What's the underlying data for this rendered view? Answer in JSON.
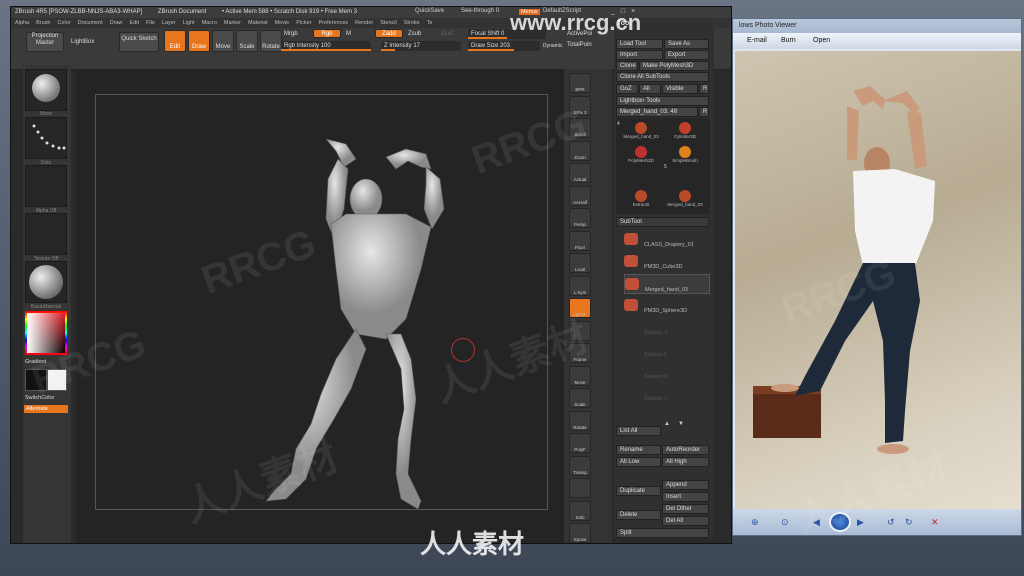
{
  "zbrush": {
    "title_parts": [
      "ZBrush 4R5 [PSOW-ZLBB-NNJS-ABA3-WHAP]",
      "ZBrush Document",
      "• Active Mem 588 • Scratch Disk 919 • Free Mem 3"
    ],
    "quicksave": "QuickSave",
    "seethrough": "See-through  0",
    "menus_btn": "Menus",
    "default_script": "DefaultZScript",
    "menu_items": [
      "Alpha",
      "Brush",
      "Color",
      "Document",
      "Draw",
      "Edit",
      "File",
      "Layer",
      "Light",
      "Macro",
      "Marker",
      "Material",
      "Movie",
      "Picker",
      "Preferences",
      "Render",
      "Stencil",
      "Stroke",
      "Te"
    ],
    "projection_master": "Projection Master",
    "lightbox": "LightBox",
    "quick_sketch": "Quick Sketch",
    "edit": "Edit",
    "draw": "Draw",
    "move": "Move",
    "scale": "Scale",
    "rotate": "Rotate",
    "mrgb": "Mrgb",
    "rgb": "Rgb",
    "m": "M",
    "zadd": "Zadd",
    "zsub": "Zsub",
    "zcut": "Zcut",
    "rgb_intensity": "Rgb Intensity 100",
    "z_intensity": "Z Intensity 17",
    "focal_shift": "Focal Shift 0",
    "draw_size": "Draw Size 203",
    "dynamic": "Dynamic",
    "active_points": "ActivePoi",
    "total_points": "TotalPoin",
    "left_caps": [
      "Move",
      "Dots",
      "Alpha Off",
      "Texture Off",
      "BasicMaterial"
    ],
    "gradient": "Gradient",
    "switch_color": "SwitchColor",
    "alternate": "Alternate",
    "right_tools": [
      "BPR",
      "SPix 3",
      "Scroll",
      "Zoom",
      "Actual",
      "AAHalf",
      "Persp",
      "Floor",
      "Local",
      "L.Sym",
      "qXYZ",
      "",
      "Frame",
      "Move",
      "Scale",
      "Rotate",
      "PolyF",
      "Transp",
      "",
      "Solo",
      "Xpose"
    ]
  },
  "tool": {
    "header": "Tool",
    "load_tool": "Load Tool",
    "save_as": "Save As",
    "import": "Import",
    "export": "Export",
    "clone": "Clone",
    "make_polymesh": "Make PolyMesh3D",
    "clone_all_subtools": "Clone All SubTools",
    "goz": "GoZ",
    "all": "All",
    "visible": "Visible",
    "r": "R",
    "lightbox_tools": "Lightbox› Tools",
    "current_tool": "Merged_hand_03. 48",
    "thumbs": [
      "Merged_hand_03",
      "Cylinder3D",
      "PolyMesh3D",
      "SimpleBrush",
      "Extract0",
      "Merged_hand_03"
    ],
    "count_4": "4",
    "count_5": "5",
    "subtool_header": "SubTool",
    "subtools": [
      "CLASS_Drapery_01",
      "PM3D_Cube3D",
      "Merged_hand_03",
      "PM3D_Sphere3D",
      "Subtool 4",
      "Subtool 5",
      "Subtool 6",
      "Subtool 7"
    ],
    "list_all": "List All",
    "rename": "Rename",
    "auto_reorder": "AutoReorder",
    "all_low": "All Low",
    "all_high": "All High",
    "duplicate": "Duplicate",
    "append": "Append",
    "insert": "Insert",
    "delete": "Delete",
    "del_other": "Del Other",
    "del_all": "Del All",
    "split": "Split"
  },
  "viewer": {
    "title": "lows Photo Viewer",
    "menu": [
      "E-mail",
      "Burn",
      "Open"
    ]
  },
  "watermark": {
    "site": "www.rrcg.cn",
    "brand": "人人素材",
    "tiles": [
      "RRCG",
      "人人素材",
      "RRCG",
      "人人素材",
      "RRCG",
      "人人素材",
      "RRCG"
    ]
  }
}
